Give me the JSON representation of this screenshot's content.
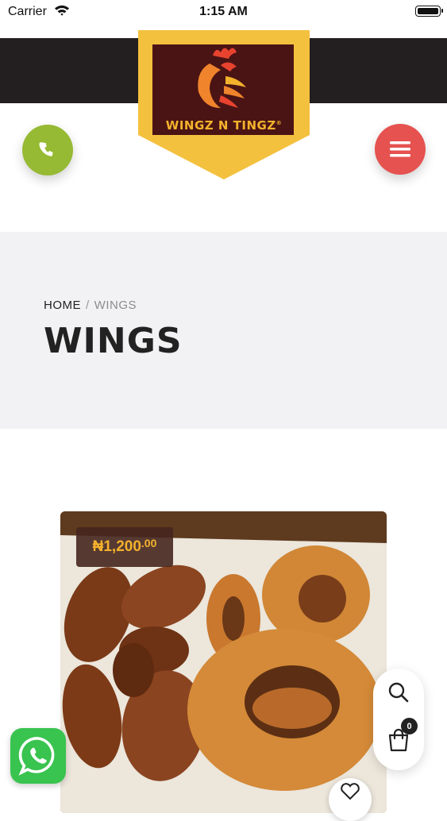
{
  "status_bar": {
    "carrier": "Carrier",
    "time": "1:15 AM"
  },
  "header": {
    "logo_text": "WINGZ N TINGZ",
    "logo_mark": "®"
  },
  "hero": {
    "breadcrumb_home": "HOME",
    "breadcrumb_separator": "/",
    "breadcrumb_current": "WINGS",
    "title": "WINGS"
  },
  "product": {
    "price_main": "₦1,200",
    "price_cents": ".00"
  },
  "cart": {
    "count": "0"
  },
  "icons": {
    "call": "phone-icon",
    "menu": "hamburger-menu-icon",
    "search": "search-icon",
    "cart": "shopping-bag-icon",
    "wishlist": "heart-icon",
    "chat": "whatsapp-icon"
  },
  "colors": {
    "header_band": "#231f20",
    "badge_yellow": "#f4c13e",
    "call_button": "#96ba33",
    "menu_button": "#e5524f",
    "hero_background": "#f2f2f4",
    "whatsapp": "#39c34f"
  }
}
